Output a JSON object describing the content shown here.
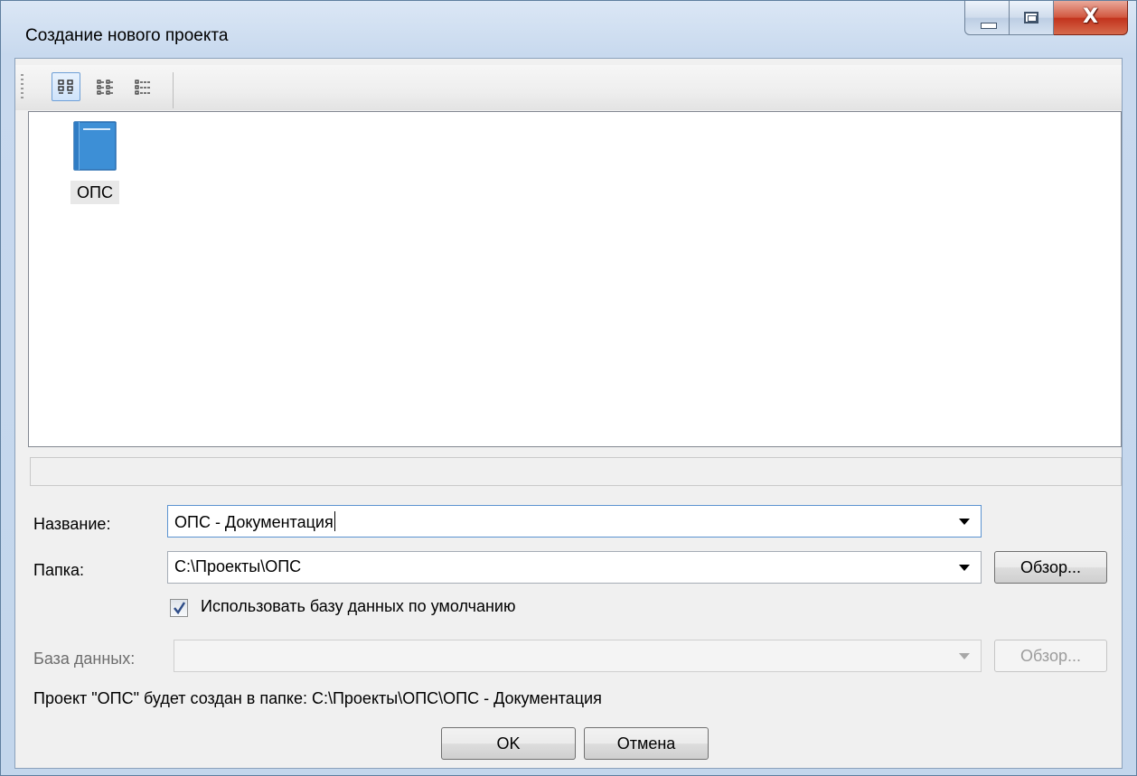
{
  "window": {
    "title": "Создание нового проекта"
  },
  "toolbar": {
    "buttons": [
      {
        "icon": "large-icons-view-icon",
        "active": true
      },
      {
        "icon": "small-icons-view-icon",
        "active": false
      },
      {
        "icon": "list-view-icon",
        "active": false
      }
    ]
  },
  "templates": [
    {
      "label": "ОПС",
      "icon": "book-icon",
      "selected": true
    }
  ],
  "form": {
    "name_label": "Название:",
    "name_value": "ОПС - Документация",
    "folder_label": "Папка:",
    "folder_value": "C:\\Проекты\\ОПС",
    "browse_label": "Обзор...",
    "use_default_db_label": "Использовать базу данных по умолчанию",
    "use_default_db_checked": true,
    "db_label": "База данных:",
    "db_value": "",
    "db_browse_label": "Обзор..."
  },
  "info_text": "Проект \"ОПС\" будет создан в папке: C:\\Проекты\\ОПС\\ОПС - Документация",
  "buttons": {
    "ok": "OK",
    "cancel": "Отмена"
  },
  "colors": {
    "accent": "#3d8fd6",
    "focus_border": "#5b93d1"
  }
}
